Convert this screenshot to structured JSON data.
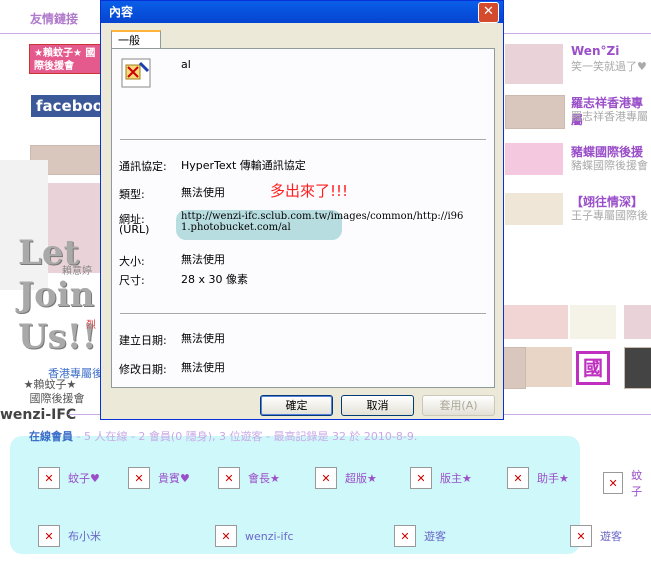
{
  "page": {
    "section_title": "友情鏈接",
    "left_banner_text": "★賴蚊子★ 國際後援會",
    "facebook_label": "facebook",
    "let_join_us": [
      "Let",
      "Join",
      "Us!!!"
    ],
    "left_caption_line1": "★賴蚊子★",
    "left_caption_line2": "國際後援會",
    "left_name": "wenzi-IFC",
    "partial_caption_1": "賴意婷",
    "partial_caption_2": "香港專屬後援",
    "partial_caption_3": "烈"
  },
  "friends": [
    {
      "name": "Wen°Zi",
      "sub": "笑一笑就過了♥"
    },
    {
      "name": "羅志祥香港專屬",
      "sub": "羅志祥香港專屬"
    },
    {
      "name": "豬蝶國際後援",
      "sub": "豬蝶國際後援會"
    },
    {
      "name": "【翊往情深】",
      "sub": "王子專屬國際後"
    }
  ],
  "country_badge": "國",
  "online": {
    "heading": "在線會員",
    "summary": " - 5 人在線 - 2 會員(0 隱身), 3 位遊客 - 最高記錄是 32 於 2010-8-9."
  },
  "legend": [
    {
      "label": "蚊子♥"
    },
    {
      "label": "貴賓♥"
    },
    {
      "label": "會長★"
    },
    {
      "label": "超版★"
    },
    {
      "label": "版主★"
    },
    {
      "label": "助手★"
    },
    {
      "label": "蚊子"
    }
  ],
  "members": [
    {
      "label": "布小米"
    },
    {
      "label": "wenzi-ifc"
    },
    {
      "label": "遊客"
    },
    {
      "label": "遊客"
    }
  ],
  "dialog": {
    "title": "內容",
    "tab": "一般",
    "filename": "al",
    "protocol_label": "通訊協定:",
    "protocol_value": "HyperText 傳輸通訊協定",
    "type_label": "類型:",
    "type_value": "無法使用",
    "address_label": "網址:",
    "address_label2": "(URL)",
    "address_value": "http://wenzi-ifc.sclub.com.tw/images/common/http://i961.photobucket.com/al",
    "size_label": "大小:",
    "size_value": "無法使用",
    "dimensions_label": "尺寸:",
    "dimensions_value": "28 x 30 像素",
    "created_label": "建立日期:",
    "created_value": "無法使用",
    "modified_label": "修改日期:",
    "modified_value": "無法使用",
    "ok": "確定",
    "cancel": "取消",
    "apply": "套用(A)",
    "annotation": "多出來了!!!"
  },
  "colors": {
    "titlebar": "#0a5ee8",
    "annotation": "#ff1e1e",
    "panel": "#cff8fb",
    "accent_purple": "#9a4fc9"
  }
}
